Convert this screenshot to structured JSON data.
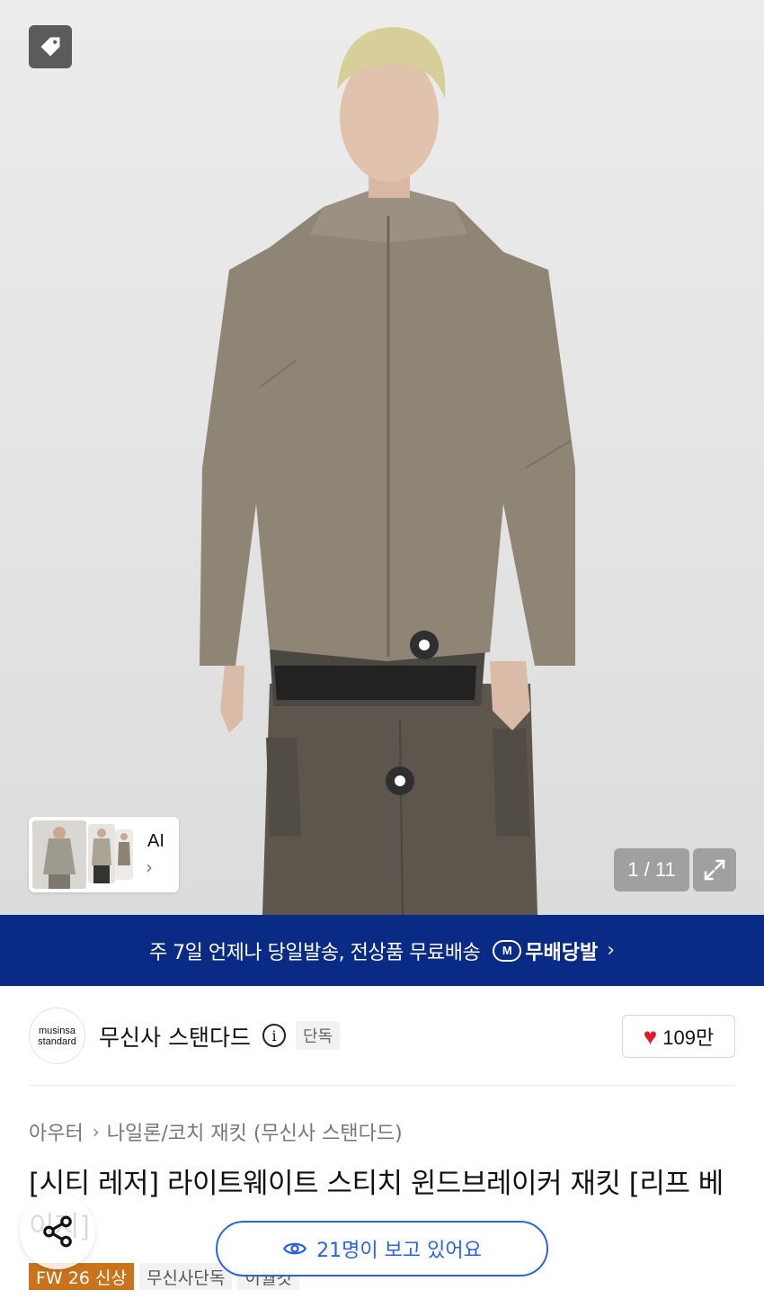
{
  "product_image": {
    "counter": "1 / 11",
    "thumbnail_label": "AI",
    "thumbnail_chevron": "›",
    "icons": [
      "tag-icon",
      "expand-icon"
    ]
  },
  "banner": {
    "text": "주 7일 언제나 당일발송, 전상품 무료배송",
    "logo_badge": "M",
    "logo_text": "무배당발",
    "chevron": "›",
    "background_color": "#0a2b85"
  },
  "brand": {
    "logo_line1": "musinsa",
    "logo_line2": "standard",
    "name": "무신사 스탠다드",
    "info_icon": "i",
    "exclusive_label": "단독",
    "like_count": "109만",
    "like_color": "#e8182a"
  },
  "breadcrumb": {
    "level1": "아우터",
    "separator": "›",
    "level2": "나일론/코치 재킷 (무신사 스탠다드)"
  },
  "product": {
    "title": "[시티 레저] 라이트웨이트 스티치 윈드브레이커 재킷 [리프 베이지]"
  },
  "badges": [
    {
      "label": "FW 26 신상",
      "color": "#c9731b"
    },
    {
      "label": "무신사단독"
    },
    {
      "label": "이월컷"
    }
  ],
  "viewers": {
    "text": "21명이 보고 있어요",
    "color": "#2b62e8"
  }
}
